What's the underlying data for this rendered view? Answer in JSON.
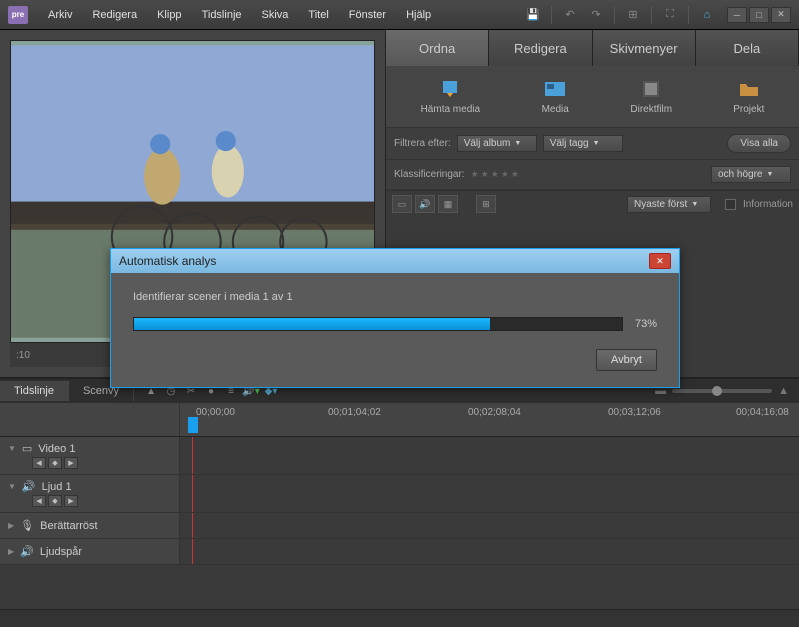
{
  "app": {
    "icon_text": "pre"
  },
  "menu": [
    "Arkiv",
    "Redigera",
    "Klipp",
    "Tidslinje",
    "Skiva",
    "Titel",
    "Fönster",
    "Hjälp"
  ],
  "main_tabs": [
    "Ordna",
    "Redigera",
    "Skivmenyer",
    "Dela"
  ],
  "media_buttons": [
    {
      "label": "Hämta media",
      "icon": "download"
    },
    {
      "label": "Media",
      "icon": "media"
    },
    {
      "label": "Direktfilm",
      "icon": "film"
    },
    {
      "label": "Projekt",
      "icon": "folder"
    }
  ],
  "filter": {
    "label": "Filtrera efter:",
    "album": "Välj album",
    "tag": "Välj tagg",
    "show_all": "Visa alla"
  },
  "rating": {
    "label": "Klassificeringar:",
    "mode": "och högre"
  },
  "view": {
    "sort": "Nyaste först",
    "info": "Information"
  },
  "preview": {
    "time": ":10"
  },
  "timeline": {
    "tabs": [
      "Tidslinje",
      "Scenvy"
    ],
    "marks": [
      "00;00;00",
      "00;01;04;02",
      "00;02;08;04",
      "00;03;12;06",
      "00;04;16;08"
    ],
    "tracks": [
      {
        "name": "Video 1",
        "type": "video",
        "nav": true
      },
      {
        "name": "Ljud 1",
        "type": "audio",
        "nav": true
      },
      {
        "name": "Berättarröst",
        "type": "mic",
        "nav": false
      },
      {
        "name": "Ljudspår",
        "type": "audio",
        "nav": false
      }
    ]
  },
  "dialog": {
    "title": "Automatisk analys",
    "status": "Identifierar scener i media  1 av 1",
    "percent": "73%",
    "percent_width": "73%",
    "cancel": "Avbryt"
  }
}
